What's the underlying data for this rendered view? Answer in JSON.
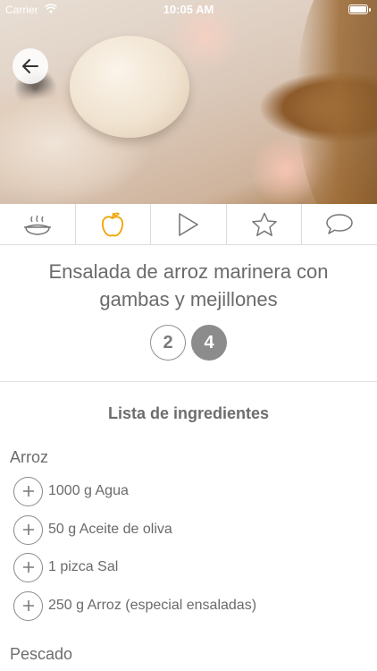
{
  "status_bar": {
    "carrier": "Carrier",
    "time": "10:05 AM"
  },
  "hero": {
    "description_icon": "back-arrow-icon"
  },
  "tabs": [
    {
      "icon": "cooking-pot-icon",
      "active": false
    },
    {
      "icon": "apple-icon",
      "active": true
    },
    {
      "icon": "play-icon",
      "active": false
    },
    {
      "icon": "star-icon",
      "active": false
    },
    {
      "icon": "speech-bubble-icon",
      "active": false
    }
  ],
  "recipe": {
    "title": "Ensalada de arroz marinera con gambas y mejillones"
  },
  "servings": {
    "options": [
      "2",
      "4"
    ],
    "selected": "4"
  },
  "ingredients": {
    "heading": "Lista de ingredientes",
    "groups": [
      {
        "name": "Arroz",
        "items": [
          "1000 g Agua",
          "50 g Aceite de oliva",
          "1 pizca Sal",
          "250 g Arroz (especial ensaladas)"
        ]
      },
      {
        "name": "Pescado",
        "items": []
      }
    ]
  },
  "colors": {
    "accent": "#f0a400",
    "text": "#6b6b6b",
    "selected_serving": "#8c8c8c"
  }
}
